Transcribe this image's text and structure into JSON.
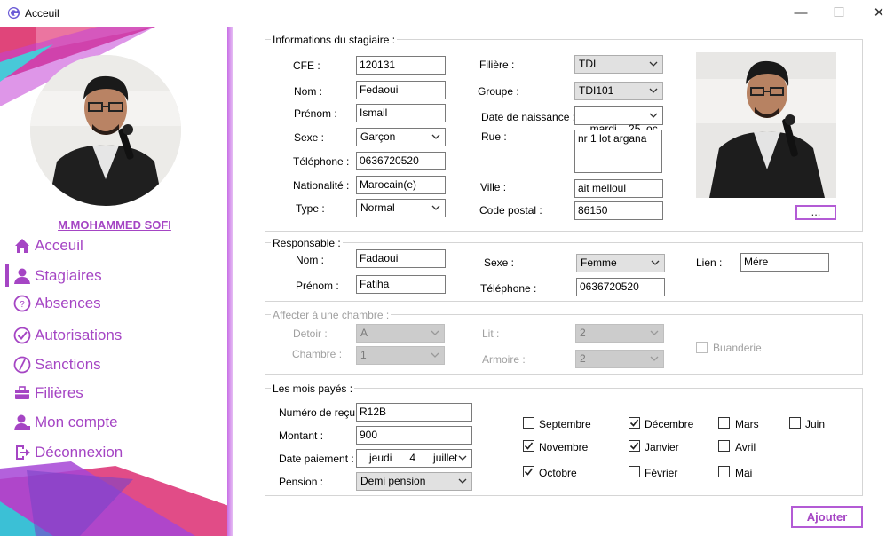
{
  "window": {
    "title": "Acceuil",
    "minimize_glyph": "—",
    "maximize_glyph": "☐",
    "close_glyph": "✕"
  },
  "sidebar": {
    "username": "M.MOHAMMED SOFI",
    "accent_color": "#a545c4",
    "items": [
      {
        "label": "Acceuil",
        "icon": "home-icon"
      },
      {
        "label": "Stagiaires",
        "icon": "user-icon",
        "active": true
      },
      {
        "label": "Absences",
        "icon": "question-circle-icon"
      },
      {
        "label": "Autorisations",
        "icon": "check-circle-icon"
      },
      {
        "label": "Sanctions",
        "icon": "slash-circle-icon"
      },
      {
        "label": "Filières",
        "icon": "briefcase-icon"
      },
      {
        "label": "Mon compte",
        "icon": "account-icon"
      },
      {
        "label": "Déconnexion",
        "icon": "logout-icon"
      }
    ]
  },
  "trainee": {
    "legend": "Informations du stagiaire :",
    "cfe_label": "CFE :",
    "cfe": "120131",
    "nom_label": "Nom :",
    "nom": "Fedaoui",
    "prenom_label": "Prénom :",
    "prenom": "Ismail",
    "sexe_label": "Sexe :",
    "sexe": "Garçon",
    "telephone_label": "Téléphone :",
    "telephone": "0636720520",
    "nationalite_label": "Nationalité :",
    "nationalite": "Marocain(e)",
    "type_label": "Type :",
    "type": "Normal",
    "filiere_label": "Filière :",
    "filiere": "TDI",
    "groupe_label": "Groupe :",
    "groupe": "TDI101",
    "date_naissance_label": "Date de naissance :",
    "date_naissance": "mardi    25  oc",
    "rue_label": "Rue :",
    "rue": "nr 1 lot argana",
    "ville_label": "Ville :",
    "ville": "ait melloul",
    "code_postal_label": "Code postal :",
    "code_postal": "86150",
    "browse_label": "..."
  },
  "responsable": {
    "legend": "Responsable :",
    "nom_label": "Nom :",
    "nom": "Fadaoui",
    "prenom_label": "Prénom :",
    "prenom": "Fatiha",
    "sexe_label": "Sexe :",
    "sexe": "Femme",
    "telephone_label": "Téléphone :",
    "telephone": "0636720520",
    "lien_label": "Lien :",
    "lien": "Mére"
  },
  "chambre": {
    "legend": "Affecter à une chambre :",
    "detoir_label": "Detoir :",
    "detoir": "A",
    "chambre_label": "Chambre :",
    "chambre": "1",
    "lit_label": "Lit :",
    "lit": "2",
    "armoire_label": "Armoire :",
    "armoire": "2",
    "buanderie_label": "Buanderie"
  },
  "paiement": {
    "legend": "Les mois payés :",
    "recu_label": "Numéro de reçu :",
    "recu": "R12B",
    "montant_label": "Montant :",
    "montant": "900",
    "date_label": "Date paiement :",
    "date": "jeudi      4      juillet",
    "pension_label": "Pension :",
    "pension": "Demi pension",
    "months": [
      {
        "label": "Septembre",
        "checked": false
      },
      {
        "label": "Novembre",
        "checked": true
      },
      {
        "label": "Octobre",
        "checked": true
      },
      {
        "label": "Décembre",
        "checked": true
      },
      {
        "label": "Janvier",
        "checked": true
      },
      {
        "label": "Février",
        "checked": false
      },
      {
        "label": "Mars",
        "checked": false
      },
      {
        "label": "Avril",
        "checked": false
      },
      {
        "label": "Mai",
        "checked": false
      },
      {
        "label": "Juin",
        "checked": false
      }
    ]
  },
  "actions": {
    "submit_label": "Ajouter"
  }
}
